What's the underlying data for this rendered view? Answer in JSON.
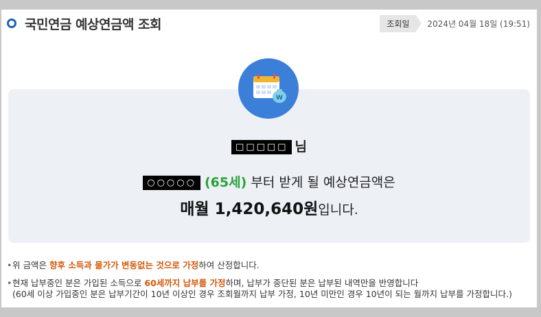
{
  "page": {
    "title": "국민연금 예상연금액 조회",
    "meta": {
      "badge": "조회일",
      "date": "2024년 04월 18일 (19:51)"
    }
  },
  "summary": {
    "name_mask": "□□□□□",
    "honorific": "님",
    "mask2": "○○○○○",
    "age": "(65세)",
    "line2_rest": "부터 받게 될 예상연금액은",
    "amount_prefix": "매월 1,420,640원",
    "amount_suffix": "입니다."
  },
  "notes": {
    "n1_pre": "위 금액은 ",
    "n1_em": "향후 소득과 물가가 변동없는 것으로 가정",
    "n1_post": "하여 산정합니다.",
    "n2_pre": "현재 납부중인 분은 가입된 소득으로 ",
    "n2_em": "60세까지 납부를 가정",
    "n2_post": "하며, 납부가 중단된 분은 납부된 내역만을 반영합니다",
    "n2_sub": "(60세 이상 가입중인 분은 납부기간이 10년 이상인 경우 조회월까지 납부 가정, 10년 미만인 경우 10년이 되는 월까지 납부를 가정합니다.)"
  },
  "colors": {
    "accent": "#1f63b5",
    "icon_bg": "#3b7fd8",
    "age": "#2aa03a",
    "emphasis": "#d2590c"
  },
  "icons": {
    "main": "calendar-money-icon"
  }
}
